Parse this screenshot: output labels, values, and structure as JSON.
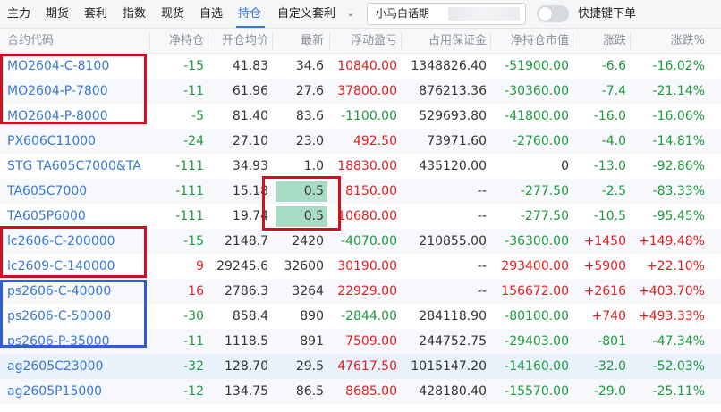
{
  "toolbar": {
    "tabs": [
      {
        "label": "主力"
      },
      {
        "label": "期货"
      },
      {
        "label": "套利"
      },
      {
        "label": "指数"
      },
      {
        "label": "现货"
      },
      {
        "label": "自选"
      },
      {
        "label": "持仓"
      },
      {
        "label": "自定义套利"
      }
    ],
    "active_tab": "持仓",
    "account_name": "小马白话期",
    "shortcut_label": "快捷键下单",
    "shortcut_enabled": false
  },
  "columns": [
    "合约代码",
    "净持仓",
    "开仓均价",
    "最新",
    "浮动盈亏",
    "占用保证金",
    "净持仓市值",
    "涨跌",
    "涨跌%"
  ],
  "rows": [
    {
      "name": "MO2604-C-8100",
      "net": "-15",
      "avg": "41.83",
      "last": "34.6",
      "pnl": "10840.00",
      "margin": "1348826.40",
      "mktval": "-51900.00",
      "chg": "-6.6",
      "chgpct": "-16.02%"
    },
    {
      "name": "MO2604-P-7800",
      "net": "-11",
      "avg": "61.96",
      "last": "27.6",
      "pnl": "37800.00",
      "margin": "876213.36",
      "mktval": "-30360.00",
      "chg": "-7.4",
      "chgpct": "-21.14%"
    },
    {
      "name": "MO2604-P-8000",
      "net": "-5",
      "avg": "81.40",
      "last": "83.6",
      "pnl": "-1100.00",
      "margin": "529693.80",
      "mktval": "-41800.00",
      "chg": "-16.0",
      "chgpct": "-16.06%"
    },
    {
      "name": "PX606C11000",
      "net": "-24",
      "avg": "27.10",
      "last": "23.0",
      "pnl": "492.50",
      "margin": "73971.60",
      "mktval": "-2760.00",
      "chg": "-4.0",
      "chgpct": "-14.81%"
    },
    {
      "name": "STG TA605C7000&TA",
      "net": "-111",
      "avg": "34.93",
      "last": "1.0",
      "pnl": "18830.00",
      "margin": "435120.00",
      "mktval": "0",
      "chg": "-13.0",
      "chgpct": "-92.86%"
    },
    {
      "name": "TA605C7000",
      "net": "-111",
      "avg": "15.18",
      "last": "0.5",
      "pnl": "8150.00",
      "margin": "--",
      "mktval": "-277.50",
      "chg": "-2.5",
      "chgpct": "-83.33%"
    },
    {
      "name": "TA605P6000",
      "net": "-111",
      "avg": "19.74",
      "last": "0.5",
      "pnl": "10680.00",
      "margin": "--",
      "mktval": "-277.50",
      "chg": "-10.5",
      "chgpct": "-95.45%"
    },
    {
      "name": "lc2606-C-200000",
      "net": "-15",
      "avg": "2148.7",
      "last": "2420",
      "pnl": "-4070.00",
      "margin": "210855.00",
      "mktval": "-36300.00",
      "chg": "+1450",
      "chgpct": "+149.48%"
    },
    {
      "name": "lc2609-C-140000",
      "net": "9",
      "avg": "29245.6",
      "last": "32600",
      "pnl": "30190.00",
      "margin": "--",
      "mktval": "293400.00",
      "chg": "+5900",
      "chgpct": "+22.10%"
    },
    {
      "name": "ps2606-C-40000",
      "net": "16",
      "avg": "2786.3",
      "last": "3264",
      "pnl": "22929.00",
      "margin": "--",
      "mktval": "156672.00",
      "chg": "+2616",
      "chgpct": "+403.70%"
    },
    {
      "name": "ps2606-C-50000",
      "net": "-30",
      "avg": "858.4",
      "last": "890",
      "pnl": "-2844.00",
      "margin": "284118.90",
      "mktval": "-80100.00",
      "chg": "+740",
      "chgpct": "+493.33%"
    },
    {
      "name": "ps2606-P-35000",
      "net": "-11",
      "avg": "1118.5",
      "last": "891",
      "pnl": "7509.00",
      "margin": "244752.75",
      "mktval": "-29403.00",
      "chg": "-801",
      "chgpct": "-47.34%"
    },
    {
      "name": "ag2605C23000",
      "net": "-32",
      "avg": "128.70",
      "last": "29.5",
      "pnl": "47617.50",
      "margin": "1015147.20",
      "mktval": "-14160.00",
      "chg": "-32.0",
      "chgpct": "-52.03%"
    },
    {
      "name": "ag2605P15000",
      "net": "-12",
      "avg": "134.75",
      "last": "86.5",
      "pnl": "8685.00",
      "margin": "428180.40",
      "mktval": "-15570.00",
      "chg": "-29.0",
      "chgpct": "-25.11%"
    }
  ],
  "colors": {
    "tab_active": "#3377e0",
    "link": "#3a78d4",
    "up": "#e02020",
    "down": "#1f9a3d",
    "highlight_cell": "#a8dcc5",
    "annotation_red": "#d4101f",
    "annotation_blue": "#2f5fd6"
  }
}
